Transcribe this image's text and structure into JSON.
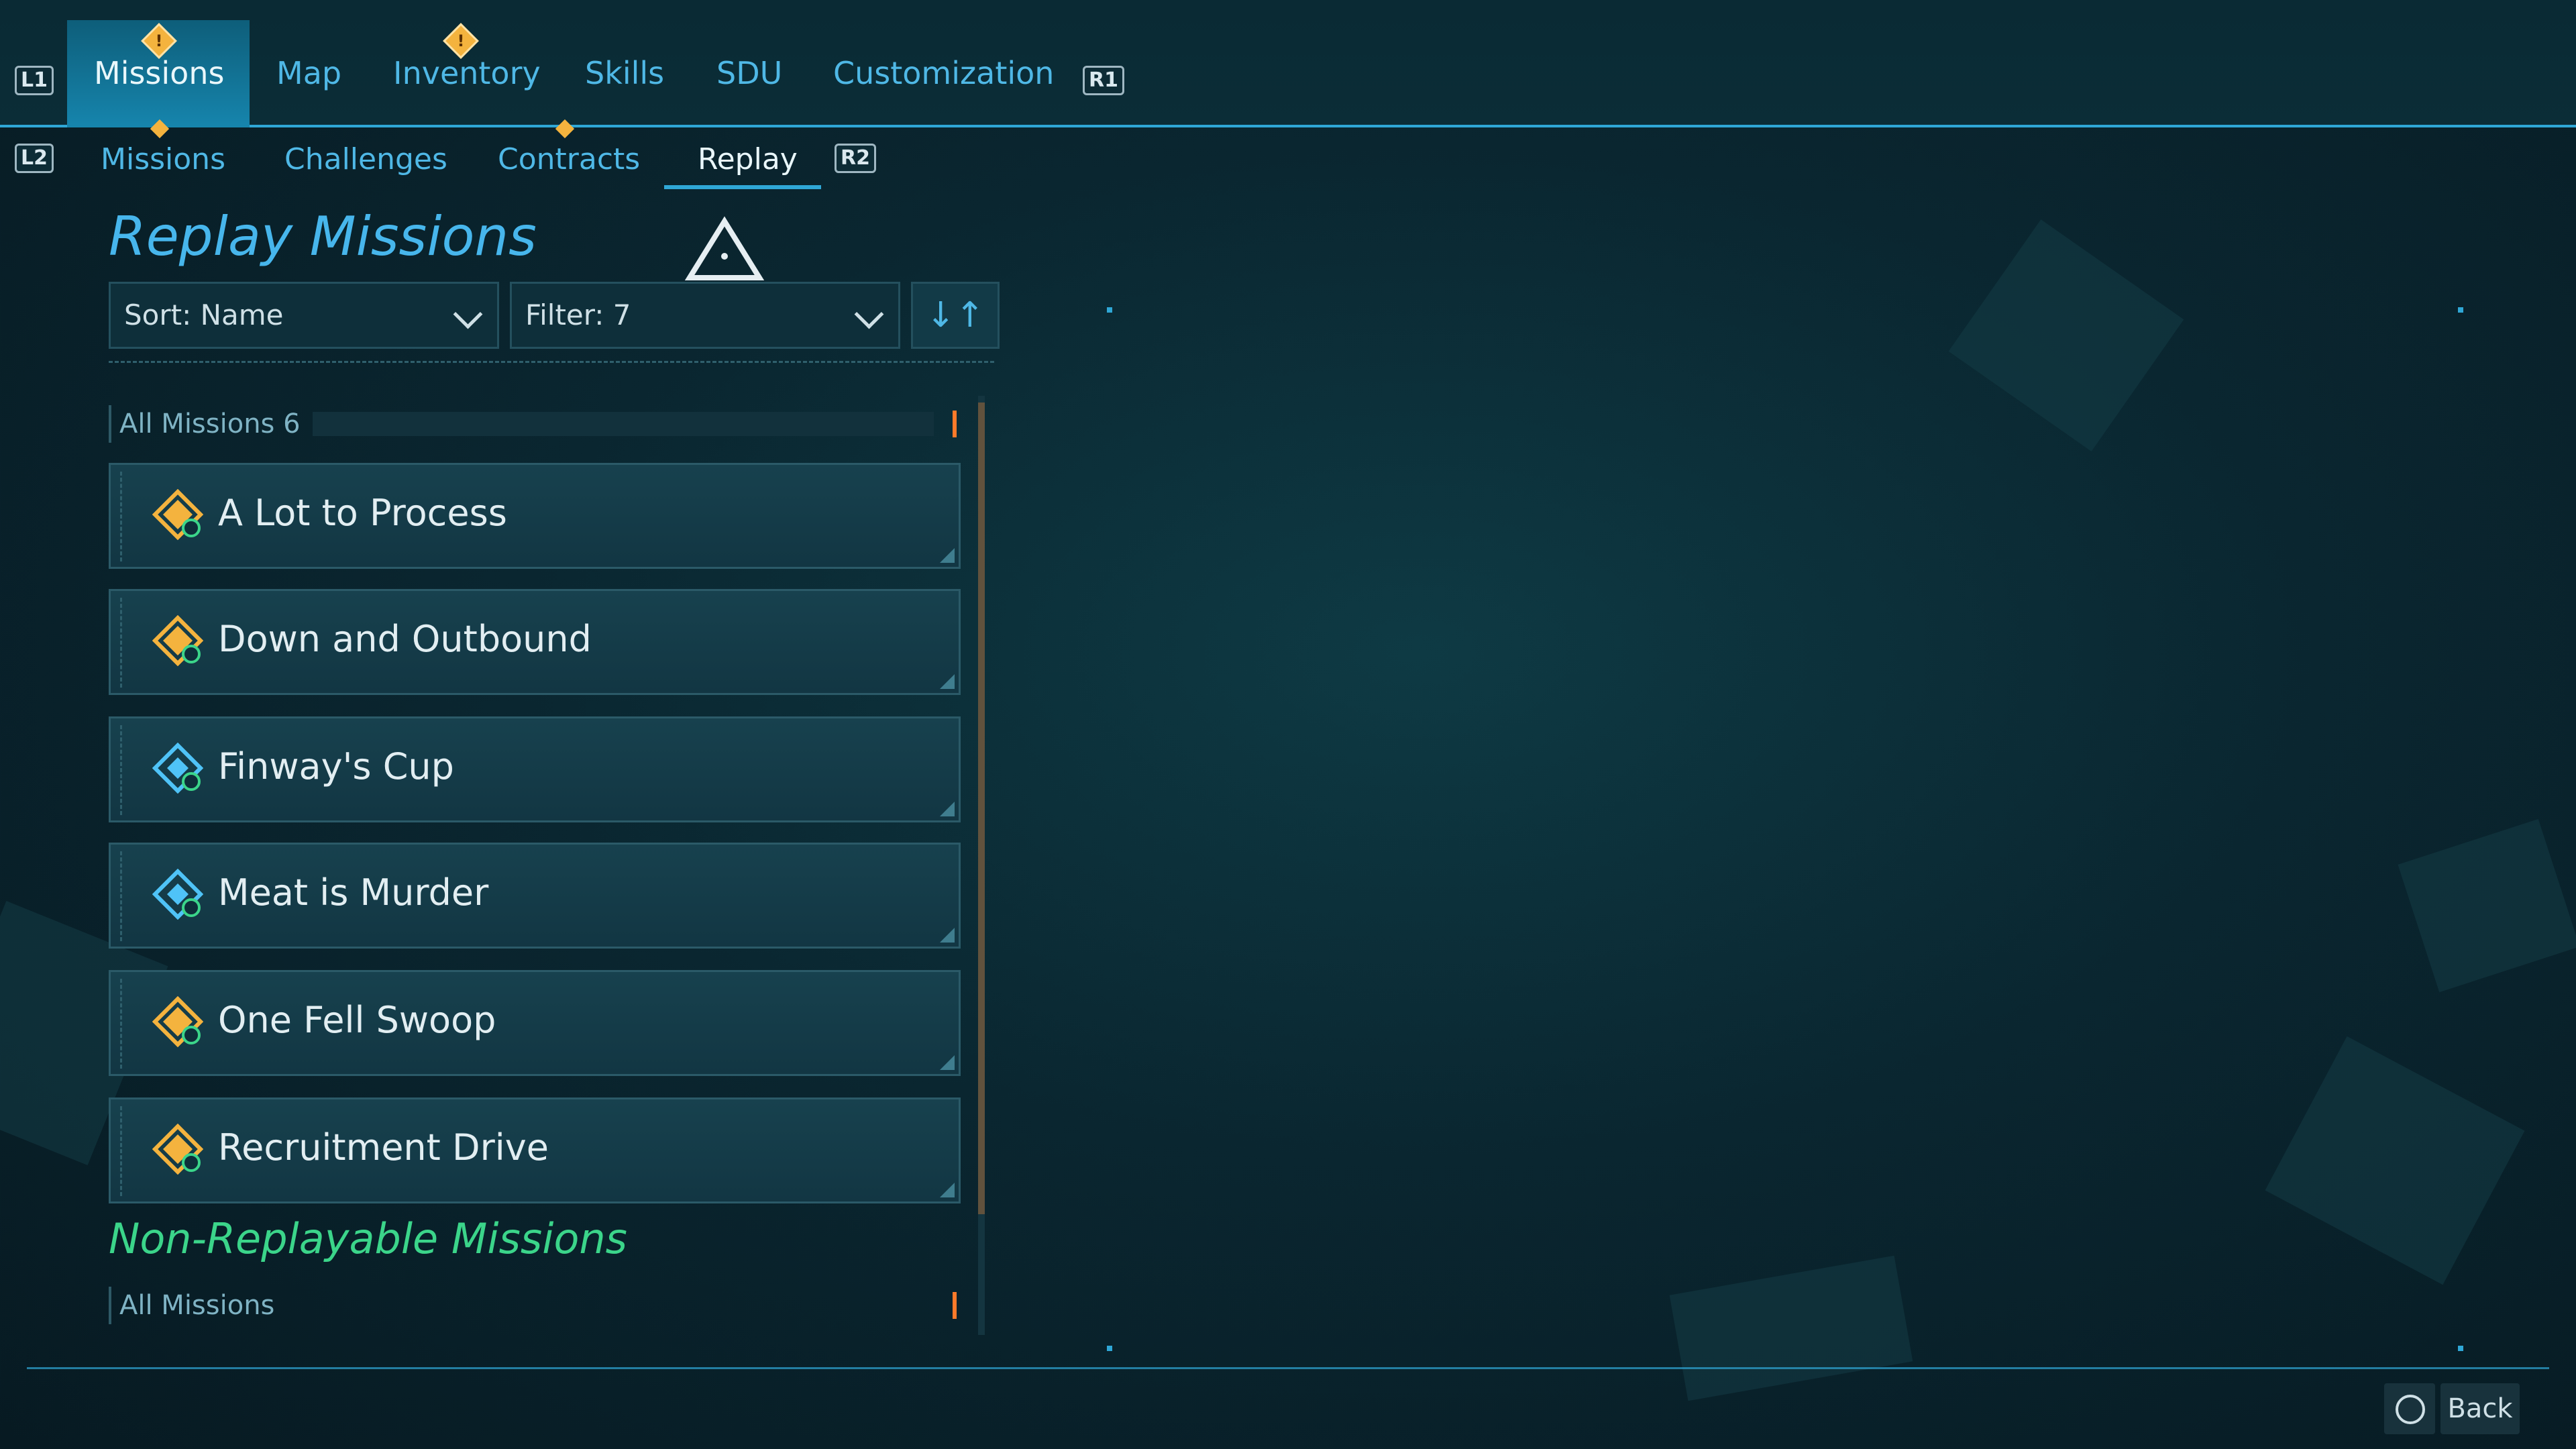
{
  "nav": {
    "left_button": "L1",
    "right_button": "R1",
    "tabs": [
      {
        "label": "Missions",
        "active": true,
        "alert": true
      },
      {
        "label": "Map",
        "active": false
      },
      {
        "label": "Inventory",
        "active": false,
        "alert": true
      },
      {
        "label": "Skills",
        "active": false
      },
      {
        "label": "SDU",
        "active": false
      },
      {
        "label": "Customization",
        "active": false
      }
    ],
    "alert_glyph": "!"
  },
  "subnav": {
    "left_button": "L2",
    "right_button": "R2",
    "tabs": [
      {
        "label": "Missions",
        "active": false
      },
      {
        "label": "Challenges",
        "active": false
      },
      {
        "label": "Contracts",
        "active": false
      },
      {
        "label": "Replay",
        "active": true
      }
    ]
  },
  "header": {
    "title": "Replay Missions",
    "sort_label": "Sort: Name",
    "filter_label": "Filter: 7",
    "sort_order_icon": "↓↑"
  },
  "replay_group": {
    "label": "All Missions 6",
    "missions": [
      {
        "name": "A Lot to Process",
        "icon": "gold-mission-replay-icon"
      },
      {
        "name": "Down and Outbound",
        "icon": "gold-mission-replay-icon"
      },
      {
        "name": "Finway's Cup",
        "icon": "blue-mission-replay-icon"
      },
      {
        "name": "Meat is Murder",
        "icon": "blue-mission-replay-icon"
      },
      {
        "name": "One Fell Swoop",
        "icon": "gold-mission-replay-icon"
      },
      {
        "name": "Recruitment Drive",
        "icon": "gold-mission-replay-icon"
      }
    ]
  },
  "non_replayable": {
    "title": "Non-Replayable Missions",
    "group_label": "All Missions"
  },
  "footer": {
    "back_label": "Back",
    "back_button_icon": "circle-button-icon"
  },
  "colors": {
    "accent_blue": "#2fa7d6",
    "gold_icon": "#f4b33e",
    "blue_icon": "#4fc3f7",
    "green_title": "#3bd58a"
  }
}
